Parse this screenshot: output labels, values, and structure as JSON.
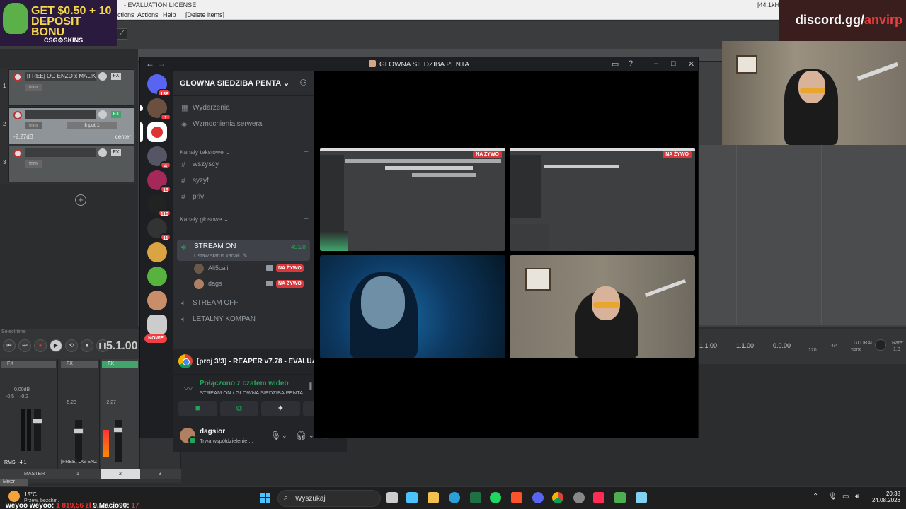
{
  "reaper": {
    "title_text": "- EVALUATION LICENSE",
    "sample_rate": "[44.1kH",
    "menu": [
      "ctions",
      "Actions",
      "Help",
      "[Delete items]"
    ],
    "tracks": [
      {
        "num": "1",
        "name": "[FREE] OG ENZO x MALIK",
        "trim": "trim"
      },
      {
        "num": "2",
        "name": "",
        "trim": "trim",
        "input": "Input 1",
        "db": "-2.27dB",
        "pan": "center"
      },
      {
        "num": "3",
        "name": "",
        "trim": "trim"
      }
    ],
    "select_time_label": "Select time",
    "position": "5.1.00",
    "pos_right": [
      "1.1.00",
      "1.1.00",
      "0.0.00"
    ],
    "bpm": "120",
    "time_sig": "4/4",
    "global_label": "GLOBAL",
    "global_value": "none",
    "rate_label": "Rate:",
    "rate_value": "1.0",
    "mixer": {
      "rms_label": "RMS",
      "rms_value": "-4.1",
      "master_label": "MASTER",
      "track_numbers": [
        "1",
        "2",
        "3"
      ],
      "strip_name": "[FREE] OG ENZ",
      "tab": "Mixer",
      "levels": [
        "0.00dB",
        "-0.5",
        "-0.2",
        "-5.23",
        "-2.27"
      ]
    }
  },
  "overlays": {
    "ad_line1": "GET $0.50 + 10",
    "ad_line2": "DEPOSIT BONU",
    "ad_brand": "CSG⚙SKINS",
    "discord_link_a": "discord.gg/",
    "discord_link_b": "anvirp"
  },
  "discord": {
    "window_title": "GLOWNA SIEDZIBA PENTA",
    "server_name": "GLOWNA SIEDZIBA PENTA",
    "guild_badges": [
      "136",
      "1",
      "4",
      "15",
      "110",
      "11"
    ],
    "guild_new": "NOWE",
    "top_items": [
      {
        "label": "Wydarzenia",
        "icon": "calendar-icon"
      },
      {
        "label": "Wzmocnienia serwera",
        "icon": "boost-icon"
      }
    ],
    "text_category": "Kanały tekstowe",
    "text_channels": [
      "wszyscy",
      "syzyf",
      "priv"
    ],
    "voice_category": "Kanały głosowe",
    "active_voice": {
      "name": "STREAM ON",
      "status": "Ustaw status kanału",
      "time": "49:28",
      "users": [
        {
          "name": "Ali5cali",
          "live": "NA ŻYWO"
        },
        {
          "name": "dags",
          "live": "NA ŻYWO"
        }
      ]
    },
    "other_voice": [
      "STREAM OFF",
      "LETALNY KOMPAN"
    ],
    "activity_title": "[proj 3/3] - REAPER v7.78 - EVALUA...",
    "voice_connected": "Połączono z czatem wideo",
    "voice_location": "STREAM ON / GLOWNA SIEDZIBA PENTA",
    "user": {
      "name": "dagsior",
      "status": "Trwa współdzielenie ..."
    },
    "live_label": "NA ŻYWO"
  },
  "taskbar": {
    "temp": "15°C",
    "weather_desc": "Przew. bezchm.",
    "search": "Wyszukaj",
    "time": "20:38",
    "date": "24.08.2026",
    "ticker_a": "weyoo weyoo:",
    "ticker_b": "1 819,56 zł",
    "ticker_c": "9.Macio90:",
    "ticker_d": "17"
  },
  "colors": {
    "discord_green": "#23a559",
    "discord_red": "#da373c",
    "reaper_green": "#3fd19a"
  }
}
